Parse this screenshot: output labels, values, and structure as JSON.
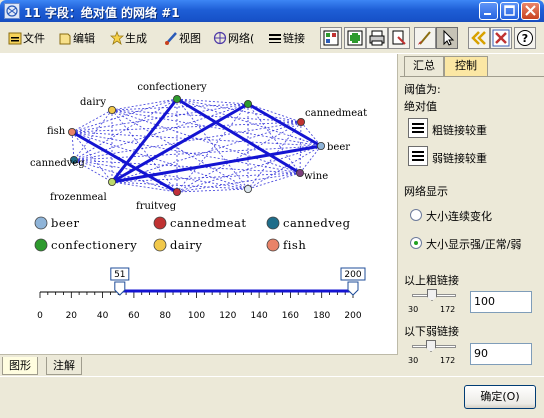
{
  "window": {
    "title": "11 字段：绝对值 的网络 #1"
  },
  "toolbar": {
    "file": "文件",
    "edit": "编辑",
    "generate": "生成",
    "view": "视图",
    "network": "网络(",
    "links": "链接"
  },
  "graph": {
    "nodes": [
      {
        "name": "confectionery",
        "label": "confectionery",
        "color": "#2e9a2e"
      },
      {
        "name": "beer-top",
        "label": "",
        "color": "#2e9a2e"
      },
      {
        "name": "cannedmeat",
        "label": "cannedmeat",
        "color": "#c03232"
      },
      {
        "name": "dairy",
        "label": "dairy",
        "color": "#f1c84a"
      },
      {
        "name": "fish",
        "label": "fish",
        "color": "#e98368"
      },
      {
        "name": "cannedveg",
        "label": "cannedveg",
        "color": "#1f6d8a"
      },
      {
        "name": "beer",
        "label": "beer",
        "color": "#8fb4d8"
      },
      {
        "name": "wine",
        "label": "wine",
        "color": "#7b3e7b"
      },
      {
        "name": "frozenmeal",
        "label": "frozenmeal",
        "color": "#bcd96a"
      },
      {
        "name": "fruitveg",
        "label": "fruitveg",
        "color": "#c0303a"
      },
      {
        "name": "softdrink",
        "label": "",
        "color": "#dbe6ec"
      }
    ],
    "strong_links": [
      [
        "confectionery",
        "wine"
      ],
      [
        "fish",
        "fruitveg"
      ],
      [
        "frozenmeal",
        "beer"
      ],
      [
        "frozenmeal",
        "beer-top"
      ],
      [
        "beer-top",
        "beer"
      ],
      [
        "frozenmeal",
        "confectionery"
      ]
    ]
  },
  "legend": [
    {
      "label": "beer",
      "color": "#8fb4d8"
    },
    {
      "label": "cannedmeat",
      "color": "#c03232"
    },
    {
      "label": "cannedveg",
      "color": "#1f6d8a"
    },
    {
      "label": "confectionery",
      "color": "#2e9a2e"
    },
    {
      "label": "dairy",
      "color": "#f1c84a"
    },
    {
      "label": "fish",
      "color": "#e98368"
    }
  ],
  "range_slider": {
    "low_value": "51",
    "high_value": "200",
    "ticks": [
      "0",
      "20",
      "40",
      "60",
      "80",
      "100",
      "120",
      "140",
      "160",
      "180",
      "200"
    ]
  },
  "bottom_tabs": {
    "graph": "图形",
    "notes": "注解"
  },
  "right_panel": {
    "tab_summary": "汇总",
    "tab_controls": "控制",
    "threshold_label": "阈值为:",
    "threshold_value": "绝对值",
    "heavy_heavier": "粗链接较重",
    "weak_heavier": "弱链接较重",
    "network_display": "网络显示",
    "option_continuous": "大小连续变化",
    "option_strong_normal_weak": "大小显示强/正常/弱",
    "above_heavy_label": "以上粗链接",
    "below_weak_label": "以下弱链接",
    "slider_min": "30",
    "slider_max": "172",
    "heavy_value": "100",
    "weak_value": "90"
  },
  "footer": {
    "ok": "确定(O)"
  }
}
